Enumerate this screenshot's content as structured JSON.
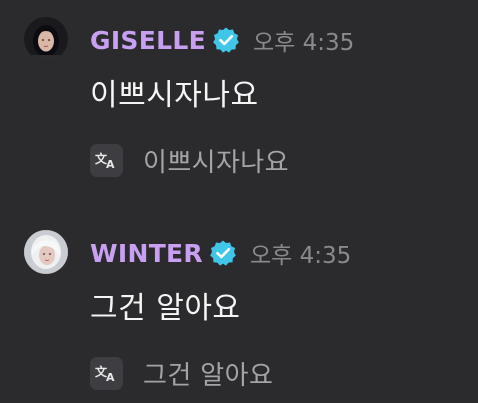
{
  "messages": [
    {
      "username": "GISELLE",
      "verified_icon": "verified-badge-icon",
      "timestamp": "오후 4:35",
      "text": "이쁘시자나요",
      "translation_icon": "translate-icon",
      "translation": "이쁘시자나요"
    },
    {
      "username": "WINTER",
      "verified_icon": "verified-badge-icon",
      "timestamp": "오후 4:35",
      "text": "그건 알아요",
      "translation_icon": "translate-icon",
      "translation": "그건 알아요"
    }
  ],
  "colors": {
    "background": "#2b2b2d",
    "username": "#c8a0f2",
    "verified_badge": "#3fc6e8",
    "timestamp": "#8a8a8e",
    "message_text": "#f5f5f5",
    "translation_text": "#a3a3a8"
  }
}
